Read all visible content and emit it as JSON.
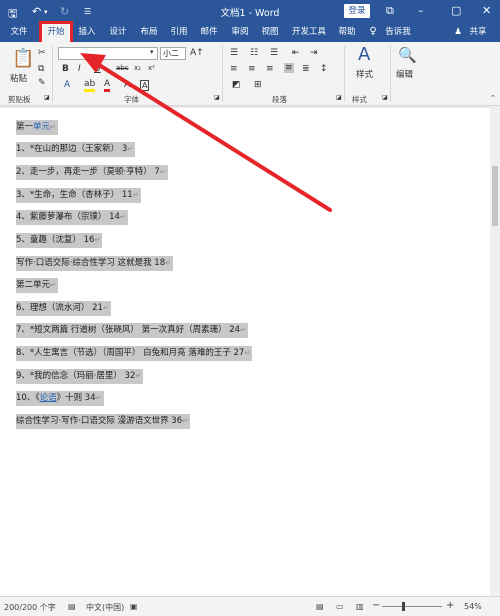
{
  "window": {
    "title": "文档1 - Word",
    "login_label": "登录",
    "minimize_icon": "minimize-icon",
    "restore_icon": "restore-icon",
    "close_icon": "close-icon"
  },
  "quick_access": {
    "save_icon": "save-icon",
    "undo_icon": "undo-icon",
    "redo_icon": "redo-icon",
    "customize_icon": "dropdown-icon"
  },
  "menu": {
    "tabs": [
      "文件",
      "开始",
      "插入",
      "设计",
      "布局",
      "引用",
      "邮件",
      "审阅",
      "视图",
      "开发工具",
      "帮助"
    ],
    "active_tab": "开始",
    "tell_me": "告诉我",
    "share": "共享"
  },
  "ribbon": {
    "groups": [
      "剪贴板",
      "字体",
      "段落",
      "样式",
      "编辑"
    ],
    "paste_label": "粘贴",
    "font_size": "小二",
    "styles_label": "样式",
    "editing_label": "编辑"
  },
  "document": {
    "lines": [
      {
        "text": "第一",
        "link": "单元",
        "tail": ""
      },
      {
        "text": "1、*在山的那边（王家新）  3",
        "link": "",
        "tail": ""
      },
      {
        "text": "2、走一步，再走一步（莫顿·亨特）     7",
        "link": "",
        "tail": ""
      },
      {
        "text": "3、*生命，生命（杏林子）   11",
        "link": "",
        "tail": ""
      },
      {
        "text": "4、紫藤萝瀑布（宗璞）    14",
        "link": "",
        "tail": ""
      },
      {
        "text": "5、童趣（沈复）   16",
        "link": "",
        "tail": ""
      },
      {
        "text": "写作·口语交际·综合性学习  这就是我     18",
        "link": "",
        "tail": ""
      },
      {
        "text": "第二单元",
        "link": "",
        "tail": ""
      },
      {
        "text": "6、理想（流水河）     21",
        "link": "",
        "tail": ""
      },
      {
        "text": "7、*短文两篇  行道树（张晓风）  第一次真好（周素珊）   24",
        "link": "",
        "tail": ""
      },
      {
        "text": "8、*人生寓言（节选）（周国平）  白兔和月亮  落难的王子    27",
        "link": "",
        "tail": ""
      },
      {
        "text": "9、*我的信念（玛丽·居里）   32",
        "link": "",
        "tail": ""
      },
      {
        "text": "10、《",
        "link": "论语",
        "tail": "》十则     34"
      },
      {
        "text": "综合性学习·写作·口语交际  漫游语文世界   36",
        "link": "",
        "tail": ""
      }
    ]
  },
  "status": {
    "words": "200/200 个字",
    "language": "中文(中国)",
    "zoom": "54%",
    "zoom_out": "−",
    "zoom_in": "+"
  }
}
